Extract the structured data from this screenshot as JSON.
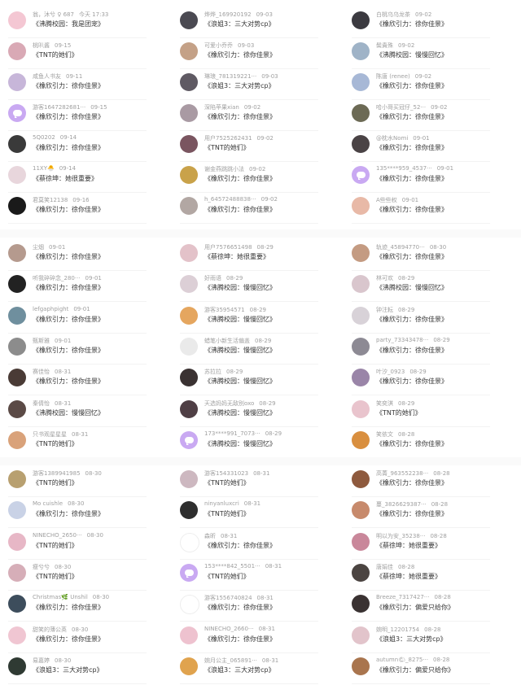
{
  "columns": [
    {
      "groups": [
        [
          {
            "name": "翁，沐兮 ♀ 687",
            "date": "今天 17:33",
            "msg": "《沸腾校园：我是团宠》",
            "avatar": "#f4c7d3"
          },
          {
            "name": "桃叭酱",
            "date": "09-15",
            "msg": "《TNT的她们》",
            "avatar": "#d9a9b5"
          },
          {
            "name": "咸鱼人书友",
            "date": "09-11",
            "msg": "《橡欣引力：徐你佳景》",
            "avatar": "#c7b6d9"
          },
          {
            "name": "游客1647282681···",
            "date": "09-15",
            "msg": "《橡欣引力：徐你佳景》",
            "avatar": "#c9a9f2",
            "app": true
          },
          {
            "name": "5Q0202",
            "date": "09-14",
            "msg": "《橡欣引力：徐你佳景》",
            "avatar": "#3a3a3a"
          },
          {
            "name": "11XY🐣",
            "date": "09-14",
            "msg": "《蔡徐坤：她很重要》",
            "avatar": "#e8d6dc"
          },
          {
            "name": "君莫笑12138",
            "date": "09-16",
            "msg": "《橡欣引力：徐你佳景》",
            "avatar": "#1a1a1a"
          }
        ],
        [
          {
            "name": "尘烟",
            "date": "09-01",
            "msg": "《橡欣引力：徐你佳景》",
            "avatar": "#b59a8e"
          },
          {
            "name": "听我碎碎念_280···",
            "date": "09-01",
            "msg": "《橡欣引力：徐你佳景》",
            "avatar": "#222222"
          },
          {
            "name": "lefgaphpight",
            "date": "09-01",
            "msg": "《橡欣引力：徐你佳景》",
            "avatar": "#6f8f9e"
          },
          {
            "name": "甄斯雅",
            "date": "09-01",
            "msg": "《橡欣引力：徐你佳景》",
            "avatar": "#8c8c8c"
          },
          {
            "name": "赛佳怡",
            "date": "08-31",
            "msg": "《橡欣引力：徐你佳景》",
            "avatar": "#4a3b36"
          },
          {
            "name": "秦倩怡",
            "date": "08-31",
            "msg": "《沸腾校园：慢慢回忆》",
            "avatar": "#5b4a46"
          },
          {
            "name": "只书观星星星",
            "date": "08-31",
            "msg": "《TNT的她们》",
            "avatar": "#d9a27a"
          }
        ],
        [
          {
            "name": "游客1389941985",
            "date": "08-30",
            "msg": "《TNT的她们》",
            "avatar": "#b8a070"
          },
          {
            "name": "Mo cuishle",
            "date": "08-30",
            "msg": "《橡欣引力：徐你佳景》",
            "avatar": "#c9d2e6"
          },
          {
            "name": "NINECHO_2650···",
            "date": "08-30",
            "msg": "《TNT的她们》",
            "avatar": "#e7b7c6"
          },
          {
            "name": "瘦兮兮",
            "date": "08-30",
            "msg": "《TNT的她们》",
            "avatar": "#d6aeb8"
          },
          {
            "name": "Christmas🌿 Unshil",
            "date": "08-30",
            "msg": "《橡欣引力：徐你佳景》",
            "avatar": "#3d4d5c"
          },
          {
            "name": "甜笑的薄公英",
            "date": "08-30",
            "msg": "《橡欣引力：徐你佳景》",
            "avatar": "#f0c6d2"
          },
          {
            "name": "易嘉婷",
            "date": "08-30",
            "msg": "《浪姐3：三大对势cp》",
            "avatar": "#2f3a33"
          }
        ]
      ]
    },
    {
      "groups": [
        [
          {
            "name": "烨烨_169920192",
            "date": "09-03",
            "msg": "《浪姐3：三大对势cp》",
            "avatar": "#4b4a52"
          },
          {
            "name": "可爱小乔乔",
            "date": "09-03",
            "msg": "《橡欣引力：徐你佳景》",
            "avatar": "#c4a187"
          },
          {
            "name": "琳琅_781319221···",
            "date": "09-03",
            "msg": "《浪姐3：三大对势cp》",
            "avatar": "#5f5a63"
          },
          {
            "name": "深陷苹果xian",
            "date": "09-02",
            "msg": "《橡欣引力：徐你佳景》",
            "avatar": "#a99aa3"
          },
          {
            "name": "用户7525262431",
            "date": "09-02",
            "msg": "《TNT的她们》",
            "avatar": "#7a5560"
          },
          {
            "name": "谢金燕跳跳小法",
            "date": "09-02",
            "msg": "《橡欣引力：徐你佳景》",
            "avatar": "#c9a24a"
          },
          {
            "name": "h_64572488838···",
            "date": "09-02",
            "msg": "《橡欣引力：徐你佳景》",
            "avatar": "#b2a7a3"
          }
        ],
        [
          {
            "name": "用户7576651498",
            "date": "08-29",
            "msg": "《蔡徐坤：她很重要》",
            "avatar": "#e3c2c9"
          },
          {
            "name": "好雨语",
            "date": "08-29",
            "msg": "《沸腾校园：慢慢回忆》",
            "avatar": "#dccfd6"
          },
          {
            "name": "游客35954571",
            "date": "08-29",
            "msg": "《沸腾校园：慢慢回忆》",
            "avatar": "#e5a65f"
          },
          {
            "name": "蜡笔小新生活偏盖",
            "date": "08-29",
            "msg": "《沸腾校园：慢慢回忆》",
            "avatar": "#eaeaea"
          },
          {
            "name": "苏拉拉",
            "date": "08-29",
            "msg": "《沸腾校园：慢慢回忆》",
            "avatar": "#3a3232"
          },
          {
            "name": "天选妈妈无敌别oxo",
            "date": "08-29",
            "msg": "《沸腾校园：慢慢回忆》",
            "avatar": "#4f3f45"
          },
          {
            "name": "173****991_7073···",
            "date": "08-29",
            "msg": "《沸腾校园：慢慢回忆》",
            "avatar": "#c9a9f2",
            "app": true
          }
        ],
        [
          {
            "name": "游客154331023",
            "date": "08-31",
            "msg": "《TNT的她们》",
            "avatar": "#cdb8c0"
          },
          {
            "name": "ninyanluxcri",
            "date": "08-31",
            "msg": "《TNT的她们》",
            "avatar": "#2e2e2e"
          },
          {
            "name": "森昕",
            "date": "08-31",
            "msg": "《橡欣引力：徐你佳景》",
            "avatar": "#ffffff"
          },
          {
            "name": "153****842_5501···",
            "date": "08-31",
            "msg": "《TNT的她们》",
            "avatar": "#c9a9f2",
            "app": true
          },
          {
            "name": "游客1556740824",
            "date": "08-31",
            "msg": "《橡欣引力：徐你佳景》",
            "avatar": "#ffffff"
          },
          {
            "name": "NINECHO_2660···",
            "date": "08-31",
            "msg": "《橡欣引力：徐你佳景》",
            "avatar": "#eec2cf"
          },
          {
            "name": "婉月公主_065891···",
            "date": "08-31",
            "msg": "《浪姐3：三大对势cp》",
            "avatar": "#e0a34e"
          }
        ]
      ]
    },
    {
      "groups": [
        [
          {
            "name": "白桃乌乌龙茶",
            "date": "09-02",
            "msg": "《橡欣引力：徐你佳景》",
            "avatar": "#3b3a40"
          },
          {
            "name": "鬓貴殊",
            "date": "09-02",
            "msg": "《沸腾校园：慢慢回忆》",
            "avatar": "#9fb3c7"
          },
          {
            "name": "陈唐 (renee)",
            "date": "09-02",
            "msg": "《橡欣引力：徐你佳景》",
            "avatar": "#a7b8d6"
          },
          {
            "name": "哈小哥买冠仔_52···",
            "date": "09-02",
            "msg": "《橡欣引力：徐你佳景》",
            "avatar": "#6c6a55"
          },
          {
            "name": "@枕水Nomi",
            "date": "09-01",
            "msg": "《橡欣引力：徐你佳景》",
            "avatar": "#4a4345"
          },
          {
            "name": "135****959_4537···",
            "date": "09-01",
            "msg": "《橡欣引力：徐你佳景》",
            "avatar": "#c9a9f2",
            "app": true
          },
          {
            "name": "A些些权",
            "date": "09-01",
            "msg": "《橡欣引力：徐你佳景》",
            "avatar": "#e8b9a7"
          }
        ],
        [
          {
            "name": "轨迹_45894770···",
            "date": "08-30",
            "msg": "《橡欣引力：徐你佳景》",
            "avatar": "#c49b82"
          },
          {
            "name": "林可欢",
            "date": "08-29",
            "msg": "《沸腾校园：慢慢回忆》",
            "avatar": "#d9c6cd"
          },
          {
            "name": "钟注耘",
            "date": "08-29",
            "msg": "《橡欣引力：徐你佳景》",
            "avatar": "#d8d2d8"
          },
          {
            "name": "party_73343478···",
            "date": "08-29",
            "msg": "《橡欣引力：徐你佳景》",
            "avatar": "#8d8a94"
          },
          {
            "name": "叶汐_0923",
            "date": "08-29",
            "msg": "《橡欣引力：徐你佳景》",
            "avatar": "#9a85a8"
          },
          {
            "name": "笑奕淇",
            "date": "08-29",
            "msg": "《TNT的她们》",
            "avatar": "#e9c4cd"
          },
          {
            "name": "笑依文",
            "date": "08-28",
            "msg": "《橡欣引力：徐你佳景》",
            "avatar": "#d98f3f"
          }
        ],
        [
          {
            "name": "高菁_963552238···",
            "date": "08-28",
            "msg": "《橡欣引力：徐你佳景》",
            "avatar": "#8e5a3e"
          },
          {
            "name": "蔓_3826629387···",
            "date": "08-28",
            "msg": "《橡欣引力：徐你佳景》",
            "avatar": "#c78a6c"
          },
          {
            "name": "明以为安_35238···",
            "date": "08-28",
            "msg": "《蔡徐坤：她很重要》",
            "avatar": "#c9879a"
          },
          {
            "name": "唐娟佳",
            "date": "08-28",
            "msg": "《蔡徐坤：她很重要》",
            "avatar": "#4b4441"
          },
          {
            "name": "Breeze_7317427···",
            "date": "08-28",
            "msg": "《橡欣引力：偏爱只给你》",
            "avatar": "#3a3232"
          },
          {
            "name": "婉明_12201754",
            "date": "08-28",
            "msg": "《浪姐3：三大对势cp》",
            "avatar": "#e2c4cb"
          },
          {
            "name": "autumn🌤_8275···",
            "date": "08-28",
            "msg": "《橡欣引力：偏爱只给你》",
            "avatar": "#a9754e"
          }
        ]
      ]
    }
  ]
}
